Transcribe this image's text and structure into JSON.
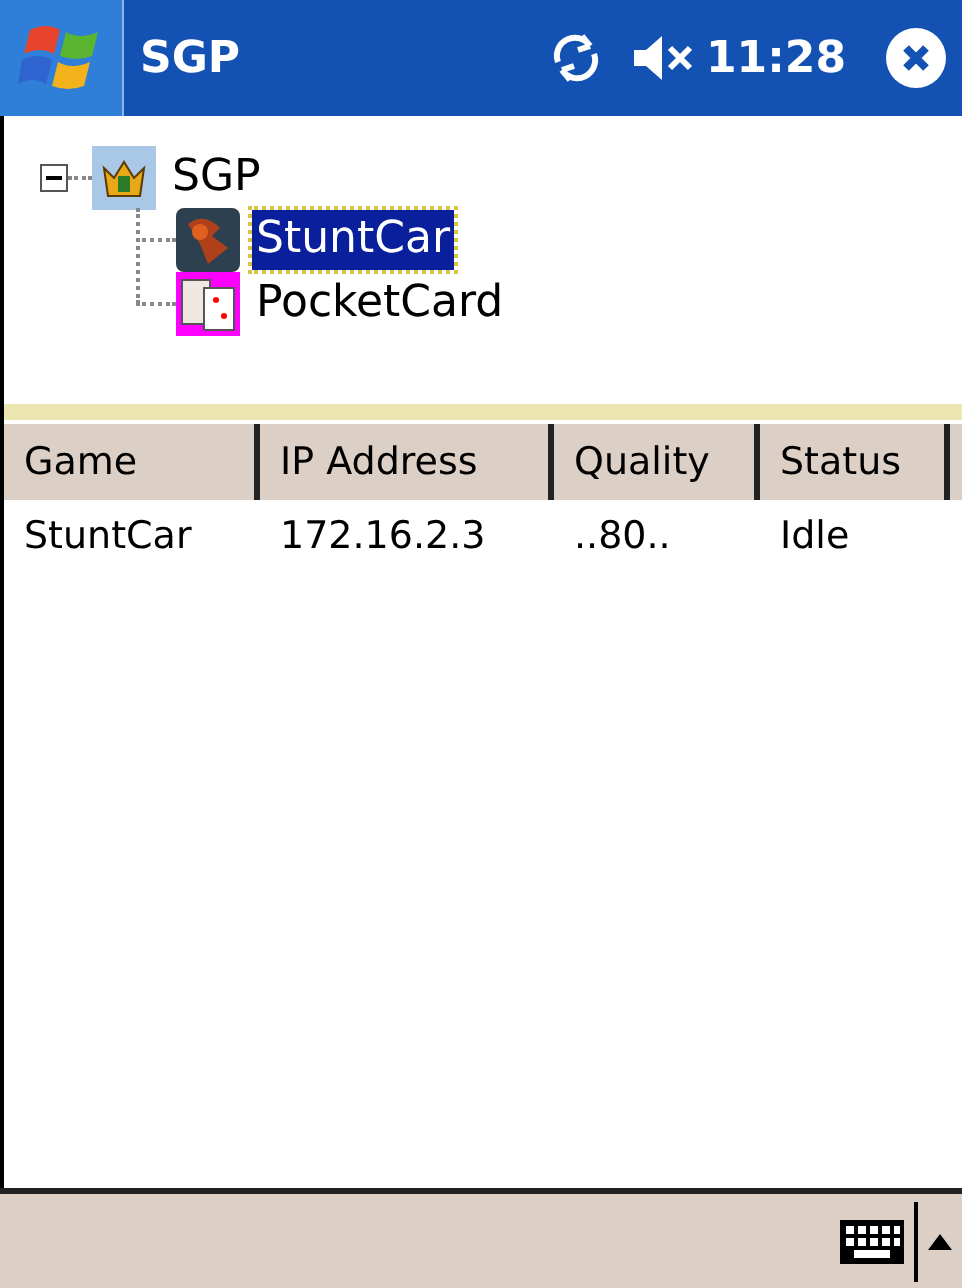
{
  "window": {
    "title": "SGP",
    "time": "11:28"
  },
  "tree": {
    "label": "SGP",
    "expanded": true,
    "children": [
      {
        "label": "StuntCar",
        "selected": true
      },
      {
        "label": "PocketCard",
        "selected": false
      }
    ]
  },
  "table": {
    "columns": [
      "Game",
      "IP Address",
      "Quality",
      "Status"
    ],
    "rows": [
      [
        "StuntCar",
        "172.16.2.3",
        "..80..",
        "Idle"
      ]
    ]
  }
}
